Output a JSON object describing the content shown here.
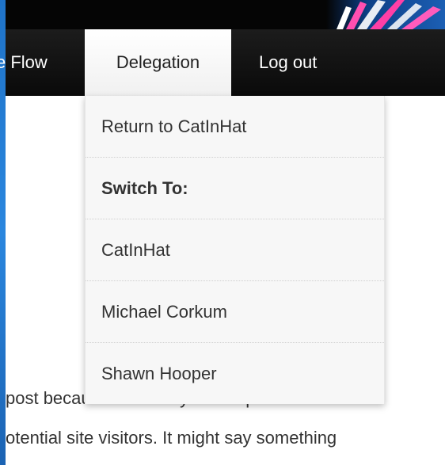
{
  "nav": {
    "items": [
      {
        "label": "e Flow"
      },
      {
        "label": "Delegation"
      },
      {
        "label": "Log out"
      }
    ]
  },
  "dropdown": {
    "return_label": "Return to CatInHat",
    "switch_header": "Switch To:",
    "users": [
      "CatInHat",
      "Michael Corkum",
      "Shawn Hooper"
    ]
  },
  "content": {
    "line1": "post because it will stay in one place and wi",
    "line2": "otential site visitors. It might say something"
  },
  "colors": {
    "accent_blue": "#1f73c8",
    "nav_background": "#111111",
    "dropdown_background": "#f7f7f7"
  }
}
